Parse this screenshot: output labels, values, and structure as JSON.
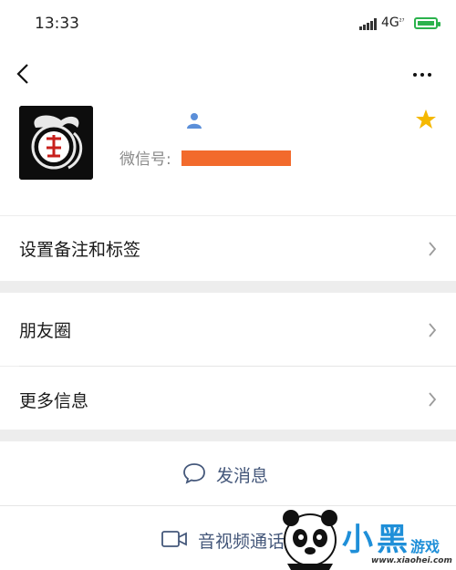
{
  "status_bar": {
    "time": "13:33",
    "network": "4G",
    "network_sub": "₂₇"
  },
  "nav": {
    "back_icon": "chevron-left-icon",
    "more_icon": "more-horizontal-icon"
  },
  "profile": {
    "avatar_icon": "dragon-logo-avatar",
    "wechat_id_label": "微信号:",
    "gender_icon": "person-icon",
    "star_icon": "star-icon",
    "colors": {
      "star": "#f5b800",
      "redaction": "#f26a2c",
      "gender": "#5b8fd9"
    }
  },
  "menu": {
    "remark_tags": "设置备注和标签",
    "moments": "朋友圈",
    "more_info": "更多信息"
  },
  "actions": {
    "send_message": "发消息",
    "av_call": "音视频通话"
  },
  "watermark": {
    "text_1": "小",
    "text_2": "黑",
    "text_3": "游戏",
    "url": "www.xiaohei.com"
  },
  "colors": {
    "link": "#44577a",
    "background": "#ededed",
    "battery": "#2bb24c"
  }
}
